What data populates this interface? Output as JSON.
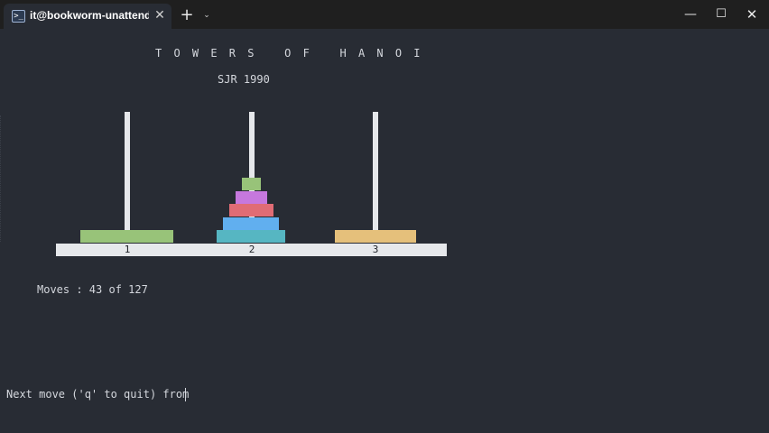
{
  "tab": {
    "icon": "terminal-icon",
    "title": "it@bookworm-unattended: ~/",
    "close_glyph": "✕"
  },
  "titlebar": {
    "new_tab_glyph": "+",
    "dropdown_glyph": "⌄",
    "minimize_glyph": "—",
    "maximize_glyph": "☐",
    "close_glyph": "✕"
  },
  "game": {
    "title": "TOWERS OF HANOI",
    "subtitle": "SJR 1990",
    "peg_labels": [
      "1",
      "2",
      "3"
    ],
    "moves_text": "Moves : 43 of 127",
    "moves_done": 43,
    "moves_total": 127,
    "prompt": "Next move ('q' to quit) from",
    "pegs": [
      {
        "label": "1",
        "disks_top_to_bottom": [
          {
            "size": 7,
            "color": "#98c379"
          }
        ]
      },
      {
        "label": "2",
        "disks_top_to_bottom": [
          {
            "size": 1,
            "color": "#98c379"
          },
          {
            "size": 2,
            "color": "#c678dd"
          },
          {
            "size": 3,
            "color": "#e06c75"
          },
          {
            "size": 4,
            "color": "#61afef"
          },
          {
            "size": 5,
            "color": "#56b6c2"
          }
        ]
      },
      {
        "label": "3",
        "disks_top_to_bottom": [
          {
            "size": 6,
            "color": "#e5c07b"
          }
        ]
      }
    ]
  },
  "colors": {
    "background": "#282c34",
    "text": "#d4d7dd",
    "peg": "#e6e8eb",
    "titlebar": "#1f1f1f"
  }
}
